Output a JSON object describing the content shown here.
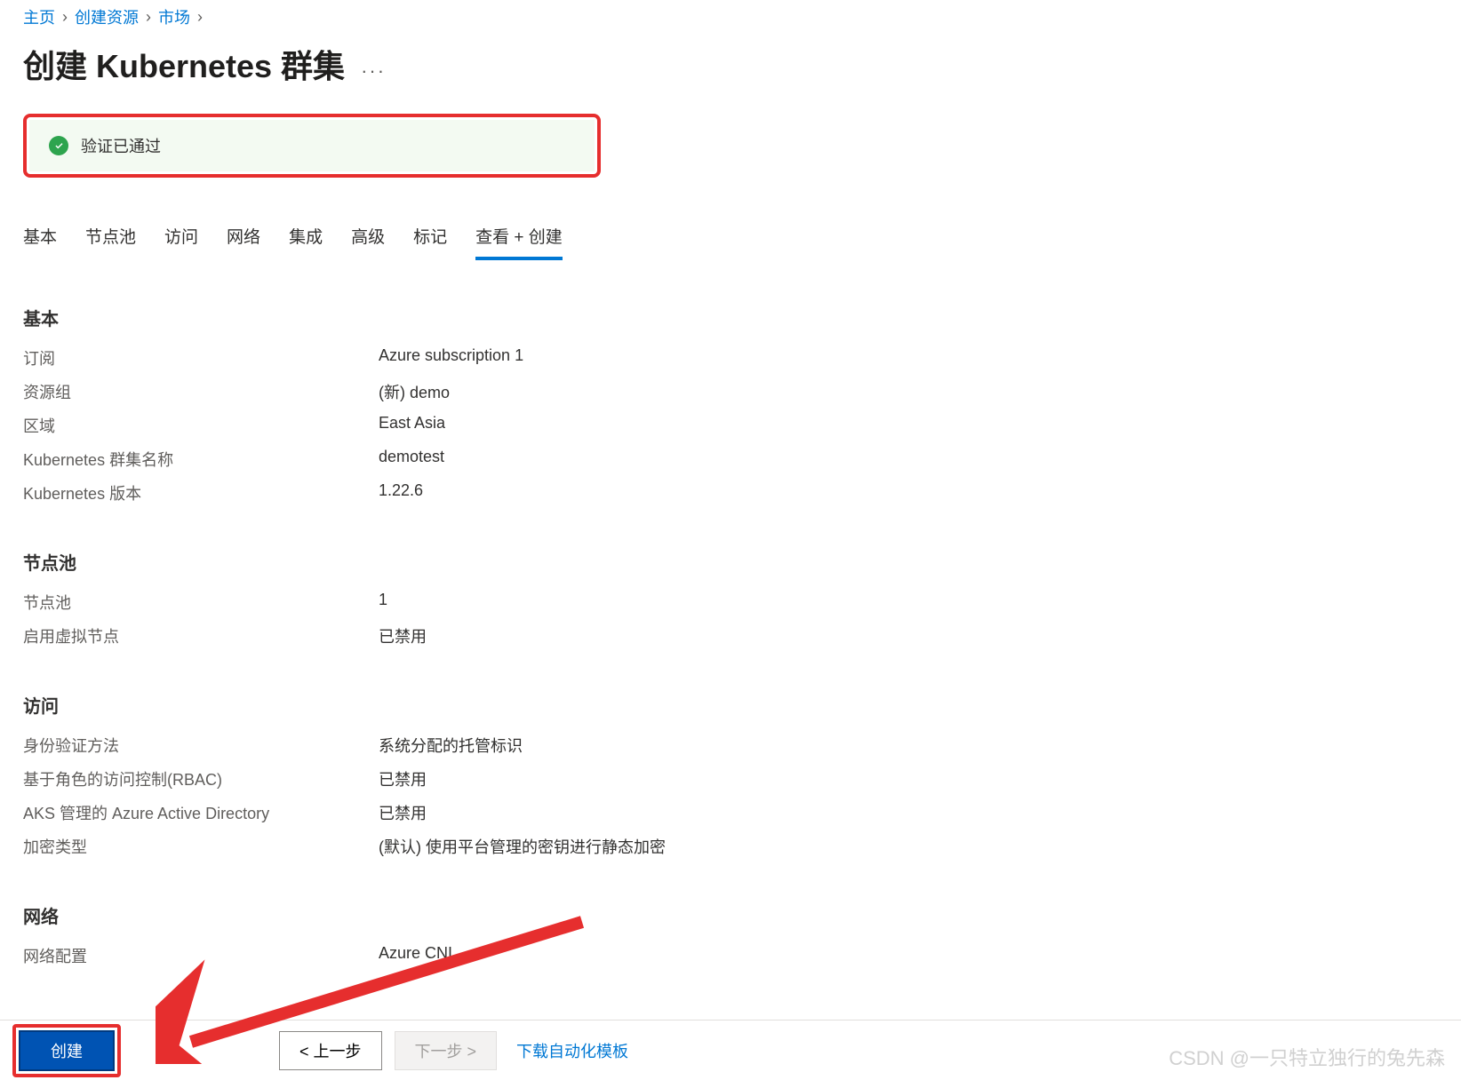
{
  "breadcrumb": {
    "items": [
      "主页",
      "创建资源",
      "市场"
    ]
  },
  "page_title": "创建 Kubernetes 群集",
  "validation": {
    "text": "验证已通过"
  },
  "tabs": {
    "items": [
      "基本",
      "节点池",
      "访问",
      "网络",
      "集成",
      "高级",
      "标记",
      "查看 + 创建"
    ],
    "active_index": 7
  },
  "sections": {
    "basic": {
      "title": "基本",
      "rows": [
        {
          "label": "订阅",
          "value": "Azure subscription 1"
        },
        {
          "label": "资源组",
          "value": "(新) demo"
        },
        {
          "label": "区域",
          "value": "East Asia"
        },
        {
          "label": "Kubernetes 群集名称",
          "value": "demotest"
        },
        {
          "label": "Kubernetes 版本",
          "value": "1.22.6"
        }
      ]
    },
    "nodepool": {
      "title": "节点池",
      "rows": [
        {
          "label": "节点池",
          "value": "1"
        },
        {
          "label": "启用虚拟节点",
          "value": "已禁用"
        }
      ]
    },
    "access": {
      "title": "访问",
      "rows": [
        {
          "label": "身份验证方法",
          "value": "系统分配的托管标识"
        },
        {
          "label": "基于角色的访问控制(RBAC)",
          "value": "已禁用"
        },
        {
          "label": "AKS 管理的 Azure Active Directory",
          "value": "已禁用"
        },
        {
          "label": "加密类型",
          "value": "(默认) 使用平台管理的密钥进行静态加密"
        }
      ]
    },
    "network": {
      "title": "网络",
      "rows": [
        {
          "label": "网络配置",
          "value": "Azure CNI"
        }
      ]
    }
  },
  "footer": {
    "create": "创建",
    "prev": "< 上一步",
    "next": "下一步 >",
    "download": "下载自动化模板"
  },
  "watermark": "CSDN @一只特立独行的兔先森"
}
